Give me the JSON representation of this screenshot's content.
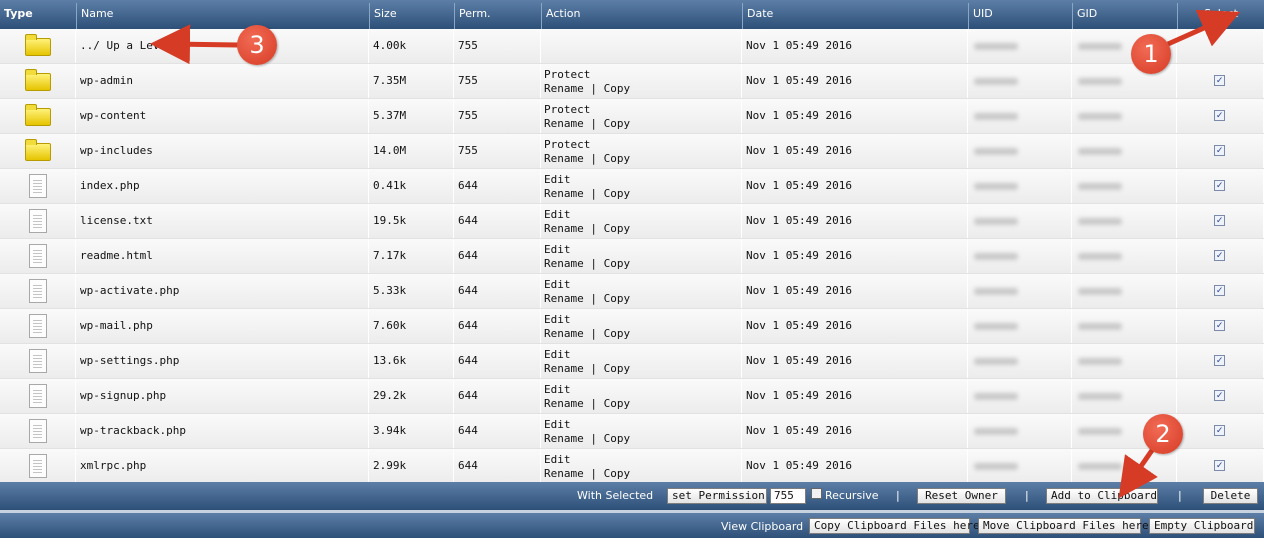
{
  "columns": {
    "type": "Type",
    "name": "Name",
    "size": "Size",
    "perm": "Perm.",
    "action": "Action",
    "date": "Date",
    "uid": "UID",
    "gid": "GID",
    "select": "Select"
  },
  "rows": [
    {
      "kind": "folder",
      "name": "../ Up a Level",
      "size": "4.00k",
      "perm": "755",
      "action1": "",
      "action2": "",
      "date": "Nov 1 05:49 2016",
      "selectable": false
    },
    {
      "kind": "folder",
      "name": "wp-admin",
      "size": "7.35M",
      "perm": "755",
      "action1": "Protect",
      "action2": "Rename | Copy",
      "date": "Nov 1 05:49 2016",
      "selectable": true
    },
    {
      "kind": "folder",
      "name": "wp-content",
      "size": "5.37M",
      "perm": "755",
      "action1": "Protect",
      "action2": "Rename | Copy",
      "date": "Nov 1 05:49 2016",
      "selectable": true
    },
    {
      "kind": "folder",
      "name": "wp-includes",
      "size": "14.0M",
      "perm": "755",
      "action1": "Protect",
      "action2": "Rename | Copy",
      "date": "Nov 1 05:49 2016",
      "selectable": true
    },
    {
      "kind": "file",
      "name": "index.php",
      "size": "0.41k",
      "perm": "644",
      "action1": "Edit",
      "action2": "Rename | Copy",
      "date": "Nov 1 05:49 2016",
      "selectable": true
    },
    {
      "kind": "file",
      "name": "license.txt",
      "size": "19.5k",
      "perm": "644",
      "action1": "Edit",
      "action2": "Rename | Copy",
      "date": "Nov 1 05:49 2016",
      "selectable": true
    },
    {
      "kind": "file",
      "name": "readme.html",
      "size": "7.17k",
      "perm": "644",
      "action1": "Edit",
      "action2": "Rename | Copy",
      "date": "Nov 1 05:49 2016",
      "selectable": true
    },
    {
      "kind": "file",
      "name": "wp-activate.php",
      "size": "5.33k",
      "perm": "644",
      "action1": "Edit",
      "action2": "Rename | Copy",
      "date": "Nov 1 05:49 2016",
      "selectable": true
    },
    {
      "kind": "file",
      "name": "wp-mail.php",
      "size": "7.60k",
      "perm": "644",
      "action1": "Edit",
      "action2": "Rename | Copy",
      "date": "Nov 1 05:49 2016",
      "selectable": true
    },
    {
      "kind": "file",
      "name": "wp-settings.php",
      "size": "13.6k",
      "perm": "644",
      "action1": "Edit",
      "action2": "Rename | Copy",
      "date": "Nov 1 05:49 2016",
      "selectable": true
    },
    {
      "kind": "file",
      "name": "wp-signup.php",
      "size": "29.2k",
      "perm": "644",
      "action1": "Edit",
      "action2": "Rename | Copy",
      "date": "Nov 1 05:49 2016",
      "selectable": true
    },
    {
      "kind": "file",
      "name": "wp-trackback.php",
      "size": "3.94k",
      "perm": "644",
      "action1": "Edit",
      "action2": "Rename | Copy",
      "date": "Nov 1 05:49 2016",
      "selectable": true
    },
    {
      "kind": "file",
      "name": "xmlrpc.php",
      "size": "2.99k",
      "perm": "644",
      "action1": "Edit",
      "action2": "Rename | Copy",
      "date": "Nov 1 05:49 2016",
      "selectable": true
    }
  ],
  "toolbar": {
    "with_selected": "With Selected",
    "set_permission": "set Permission",
    "permission_value": "755",
    "recursive": "Recursive",
    "reset_owner": "Reset Owner",
    "add_to_clipboard": "Add to Clipboard",
    "delete": "Delete",
    "separator": "|"
  },
  "clipboard_bar": {
    "view_clipboard": "View Clipboard",
    "copy_files": "Copy Clipboard Files here",
    "move_files": "Move Clipboard Files here",
    "empty": "Empty Clipboard"
  },
  "callouts": [
    "1",
    "2",
    "3"
  ],
  "icons": {
    "folder": "folder-icon",
    "file": "file-icon",
    "checkbox": "checkbox-icon"
  },
  "colors": {
    "header": "#2d5078",
    "callout": "#d63b25",
    "folder": "#e6c400"
  }
}
